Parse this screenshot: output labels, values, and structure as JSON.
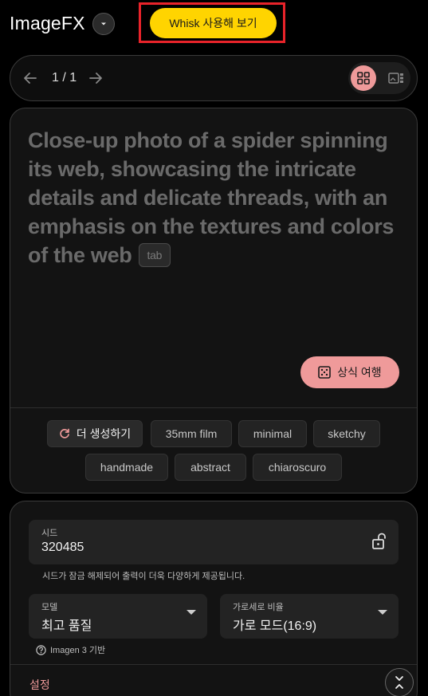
{
  "header": {
    "logo": "ImageFX",
    "whisk_button": "Whisk 사용해 보기"
  },
  "pager": {
    "count": "1 / 1"
  },
  "prompt": {
    "text": "Close-up photo of a spider spinning its web, showcasing the intricate details and delicate threads, with an emphasis on the textures and colors of the web",
    "tab_hint": "tab",
    "trip_button": "상식 여행"
  },
  "chips": {
    "regenerate": "더 생성하기",
    "items": [
      "35mm film",
      "minimal",
      "sketchy",
      "handmade",
      "abstract",
      "chiaroscuro"
    ]
  },
  "settings": {
    "seed_label": "시드",
    "seed_value": "320485",
    "seed_note": "시드가 잠금 해제되어 출력이 더욱 다양하게 제공됩니다.",
    "model_label": "모델",
    "model_value": "최고 품질",
    "ratio_label": "가로세로 비율",
    "ratio_value": "가로 모드(16:9)",
    "imagen_note": "Imagen 3 기반",
    "section_label": "설정"
  },
  "colors": {
    "accent_yellow": "#ffd400",
    "accent_pink": "#ef9a9a",
    "highlight_red": "#e8232a",
    "background": "#000000"
  },
  "icons": {
    "logo_menu": "chevron-down-icon",
    "prev": "arrow-left-icon",
    "next": "arrow-right-icon",
    "grid_view": "grid-view-icon",
    "single_view": "single-view-icon",
    "trip": "dice-icon",
    "regenerate": "refresh-icon",
    "lock": "unlock-icon",
    "help": "help-icon",
    "collapse": "collapse-icon"
  }
}
